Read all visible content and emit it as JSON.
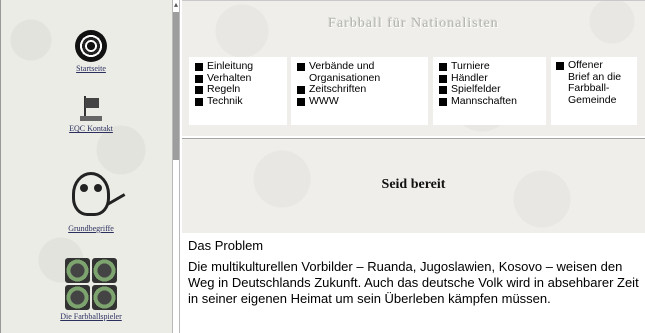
{
  "sidebar": {
    "items": [
      {
        "caption": "Startseite",
        "icon": "farbball-icon"
      },
      {
        "caption": "EQC Kontakt",
        "icon": "flag-icon"
      },
      {
        "caption": "Grundbegriffe",
        "icon": "head-icon"
      },
      {
        "caption": "Die Farbballspieler",
        "icon": "balls-icon"
      }
    ]
  },
  "header": {
    "title": "Farbball für Nationalisten"
  },
  "menu": {
    "col1": [
      "Einleitung",
      "Verhalten",
      "Regeln",
      "Technik"
    ],
    "col2": [
      "Verbände und",
      "Organisationen",
      "Zeitschriften",
      "WWW"
    ],
    "col3": [
      "Turniere",
      "Händler",
      "Spielfelder",
      "Mannschaften"
    ],
    "col4": [
      "Offener",
      "Brief an die",
      "Farbball-",
      "Gemeinde"
    ]
  },
  "banner": {
    "text": "Seid bereit"
  },
  "content": {
    "heading": "Das Problem",
    "paragraph": "Die multikulturellen Vorbilder – Ruanda, Jugoslawien, Kosovo – weisen den Weg in Deutschlands Zukunft. Auch das deutsche Volk wird in absehbarer Zeit in seiner eigenen Heimat um sein Überleben kämpfen müssen."
  }
}
